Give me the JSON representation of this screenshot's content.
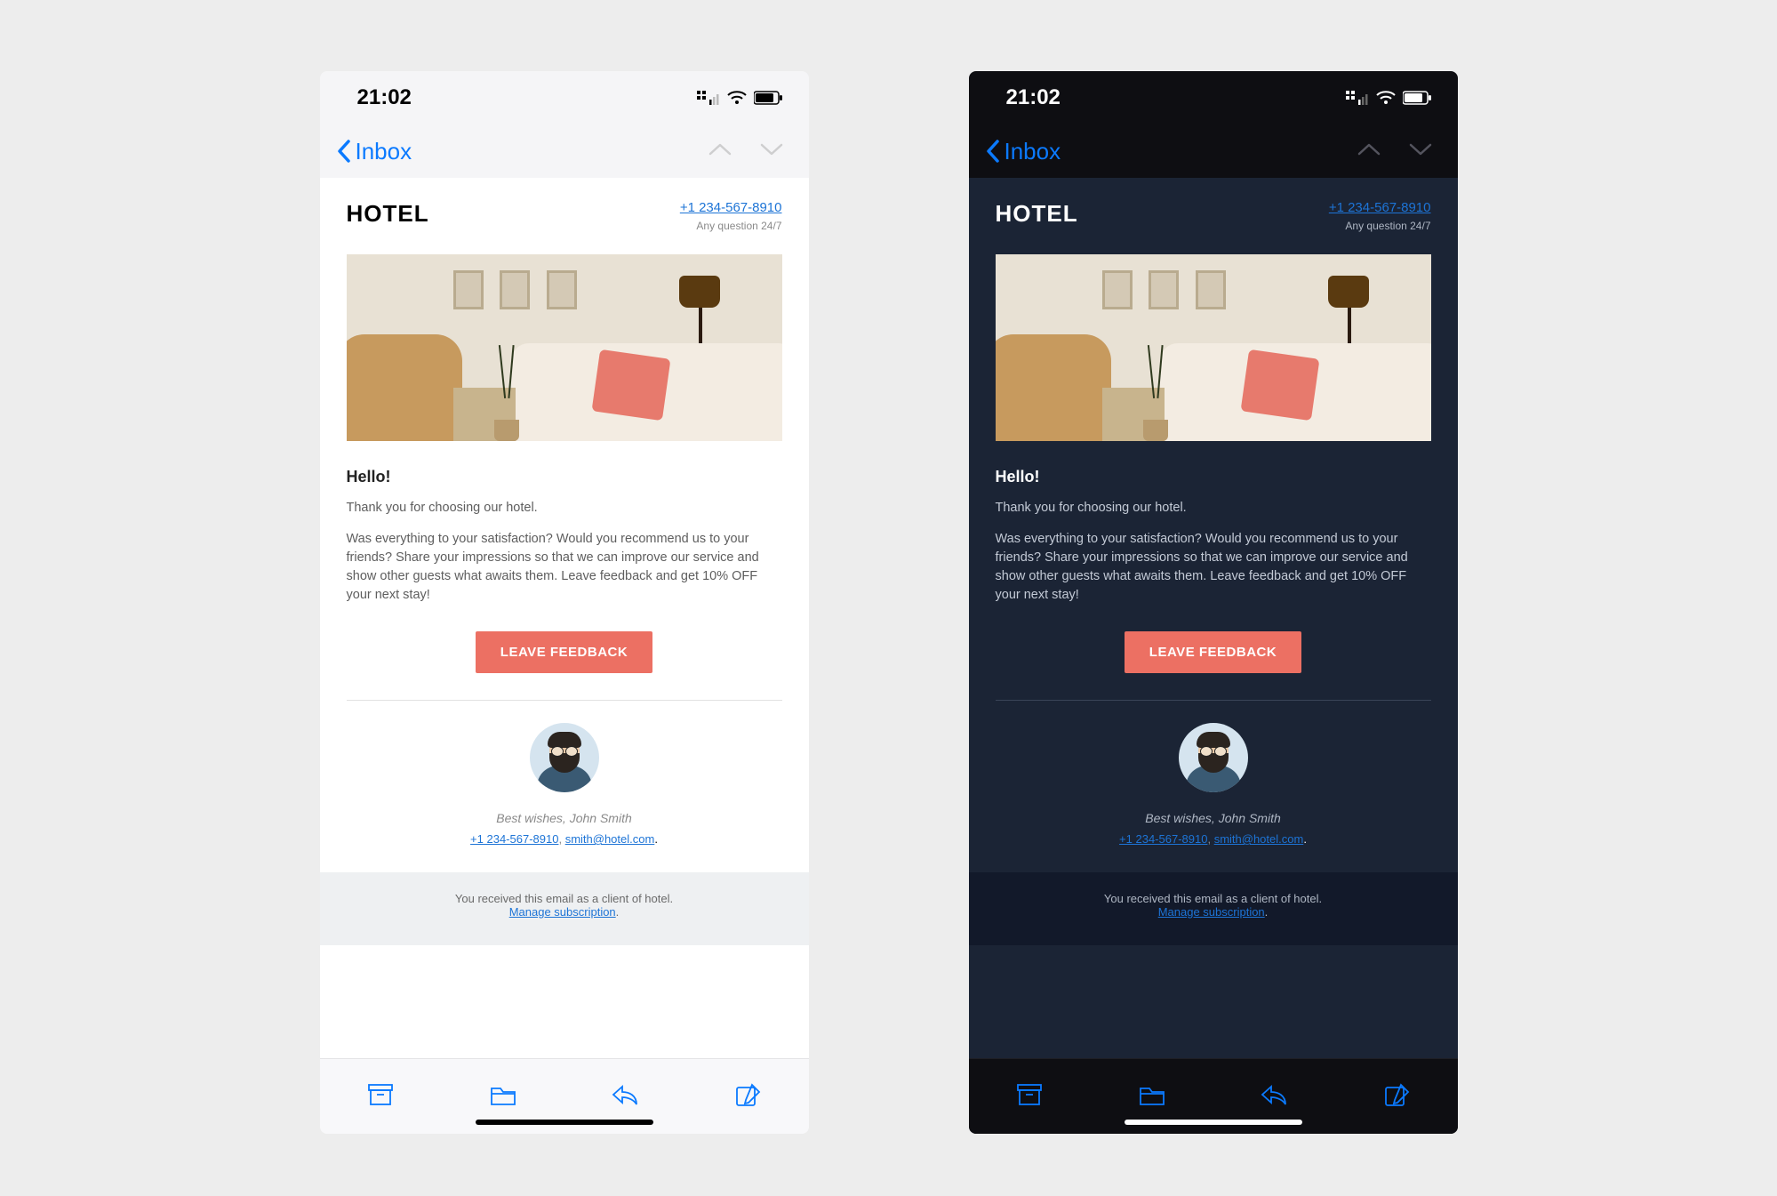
{
  "status": {
    "time": "21:02"
  },
  "nav": {
    "back_label": "Inbox"
  },
  "email": {
    "logo": "HOTEL",
    "contact_phone": "+1 234-567-8910",
    "contact_sub": "Any question 24/7",
    "greeting": "Hello!",
    "intro": "Thank you for choosing our hotel.",
    "body": "Was everything to your satisfaction? Would you recommend us to your friends? Share your impressions so that we can improve our service and show other guests what awaits them. Leave feedback and get 10% OFF your next stay!",
    "cta": "LEAVE FEEDBACK",
    "wishes": "Best wishes, John Smith",
    "sig_phone": "+1 234-567-8910",
    "sig_sep": ", ",
    "sig_email": "smith@hotel.com",
    "sig_period": ".",
    "footer_line": "You received this email as a client of hotel.",
    "footer_link": "Manage subscription",
    "footer_period": "."
  }
}
